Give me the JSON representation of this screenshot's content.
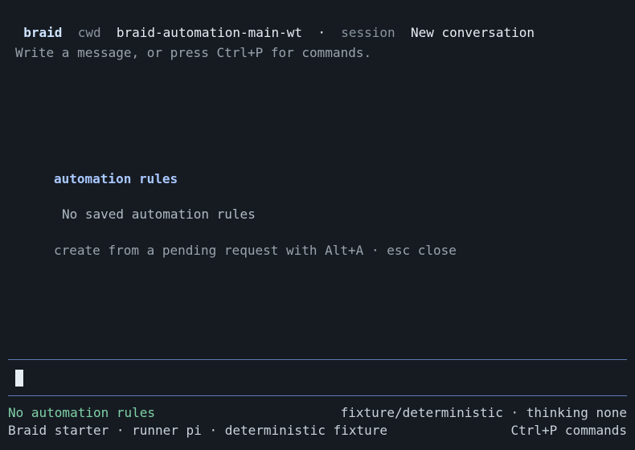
{
  "header": {
    "app": "braid",
    "cwd_label": "cwd",
    "cwd": "braid-automation-main-wt",
    "separator": "·",
    "session_label": "session",
    "session": "New conversation"
  },
  "composer": {
    "placeholder": "Write a message, or press Ctrl+P for commands."
  },
  "modal": {
    "title": "automation rules",
    "empty_message": "No saved automation rules",
    "hint": "create from a pending request with Alt+A · esc close"
  },
  "status": {
    "left_line1": "No automation rules",
    "right_line1": "fixture/deterministic · thinking none",
    "left_line2": "Braid starter · runner pi · deterministic fixture",
    "right_line2": "Ctrl+P commands"
  }
}
